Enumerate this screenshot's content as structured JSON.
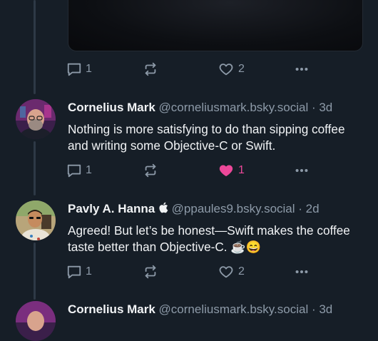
{
  "top_post": {
    "actions": {
      "reply_count": "1",
      "like_count": "2"
    }
  },
  "posts": [
    {
      "name": "Cornelius Mark",
      "handle": "@corneliusmark.bsky.social",
      "time": "· 3d",
      "text": "Nothing is more satisfying to do than sipping coffee and writing some Objective-C or Swift.",
      "reply_count": "1",
      "like_count": "1",
      "liked": true
    },
    {
      "name": "Pavly A. Hanna",
      "name_badge": "",
      "handle": "@ppaules9.bsky.social",
      "time": "· 2d",
      "text": "Agreed! But let’s be honest—Swift makes the coffee taste better than Objective-C. ☕😄",
      "reply_count": "1",
      "like_count": "2",
      "liked": false
    },
    {
      "name": "Cornelius Mark",
      "handle": "@corneliusmark.bsky.social",
      "time": "· 3d"
    }
  ],
  "icons": {
    "reply": "reply-icon",
    "repost": "repost-icon",
    "like": "heart-icon",
    "more": "more-icon"
  },
  "colors": {
    "background": "#161e27",
    "secondary_text": "#8d9aa8",
    "like_active": "#ec4899",
    "thread_line": "#2e3946"
  }
}
